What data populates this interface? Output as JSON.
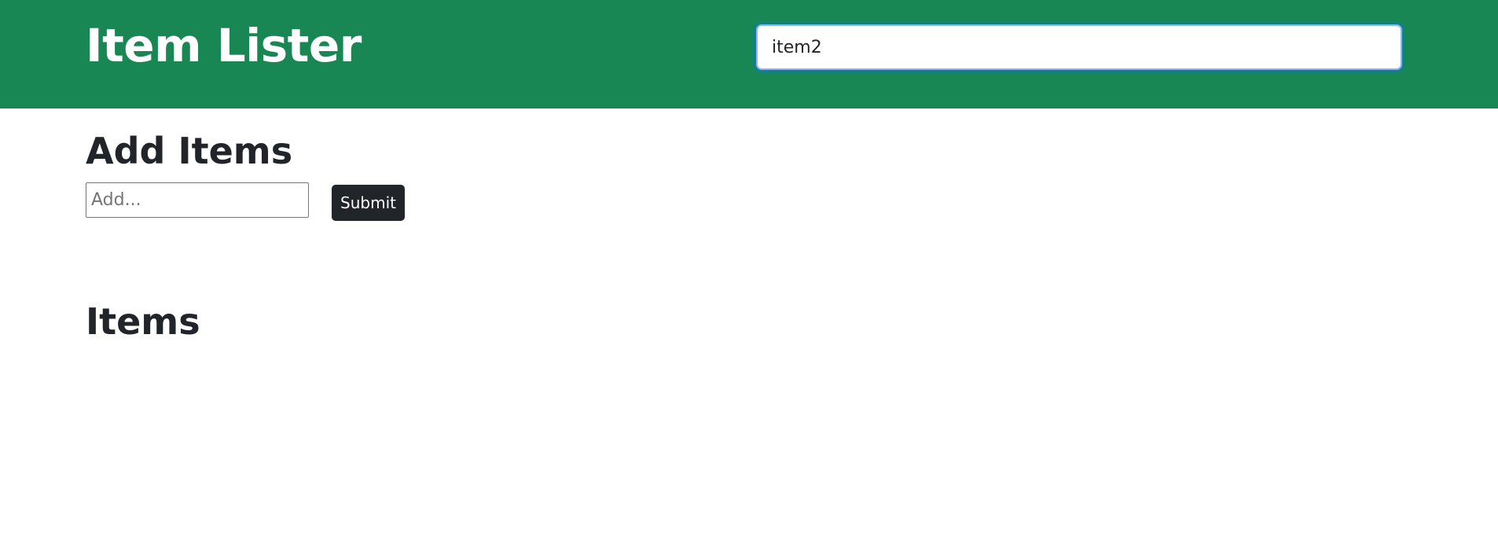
{
  "header": {
    "title": "Item Lister",
    "filter": {
      "value": "item2",
      "placeholder": ""
    },
    "background_color": "#198754"
  },
  "add_section": {
    "title": "Add Items",
    "input": {
      "value": "",
      "placeholder": "Add..."
    },
    "submit_label": "Submit"
  },
  "items_section": {
    "title": "Items",
    "items": []
  }
}
